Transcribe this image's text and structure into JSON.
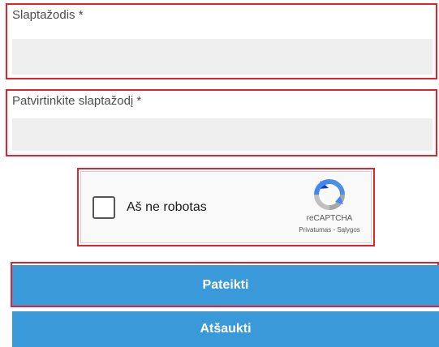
{
  "form": {
    "password": {
      "label": "Slaptažodis *",
      "value": "",
      "placeholder": ""
    },
    "confirm_password": {
      "label": "Patvirtinkite slaptažodį *",
      "value": "",
      "placeholder": ""
    }
  },
  "captcha": {
    "checkbox_label": "Aš ne robotas",
    "brand": "reCAPTCHA",
    "links": "Privatumas - Sąlygos",
    "checked": false
  },
  "buttons": {
    "submit_label": "Pateikti",
    "cancel_label": "Atšaukti"
  },
  "colors": {
    "highlight": "#e0232d",
    "button": "#3a9ad9",
    "input_bg": "#efefef"
  }
}
